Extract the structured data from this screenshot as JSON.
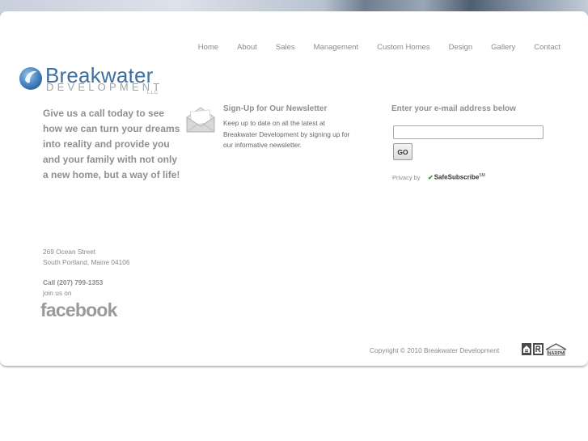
{
  "nav": {
    "items": [
      "Home",
      "About",
      "Sales",
      "Management",
      "Custom Homes",
      "Design",
      "Gallery",
      "Contact"
    ]
  },
  "logo": {
    "line1": "Breakwater",
    "line2": "DEVELOPMENT",
    "line3": "LLC",
    "accent": "#3f6ea2"
  },
  "tagline": "Give us a call today to see how we can turn your dreams into reality and provide you and your family with not only a new home, but a way of life!",
  "newsletter": {
    "icon": "envelope-icon",
    "title": "Sign-Up for Our Newsletter",
    "description": "Keep up to date on all the latest at Breakwater Development by signing up for our informative newsletter."
  },
  "signup": {
    "label": "Enter your e-mail address below",
    "input_value": "",
    "go_label": "GO",
    "privacy_text": "Privacy by",
    "provider": "SafeSubscribe",
    "provider_mark": "SM"
  },
  "contact": {
    "address_line1": "269 Ocean Street",
    "address_line2": "South Portland, Maine 04106",
    "phone": "Call (207) 799-1353",
    "join": "join us on",
    "social": "facebook"
  },
  "footer": {
    "copyright": "Copyright © 2010 Breakwater Development",
    "badges": [
      "equal-housing-icon",
      "realtor-icon",
      "narpm-icon"
    ],
    "narpm_text": "NARPM"
  }
}
